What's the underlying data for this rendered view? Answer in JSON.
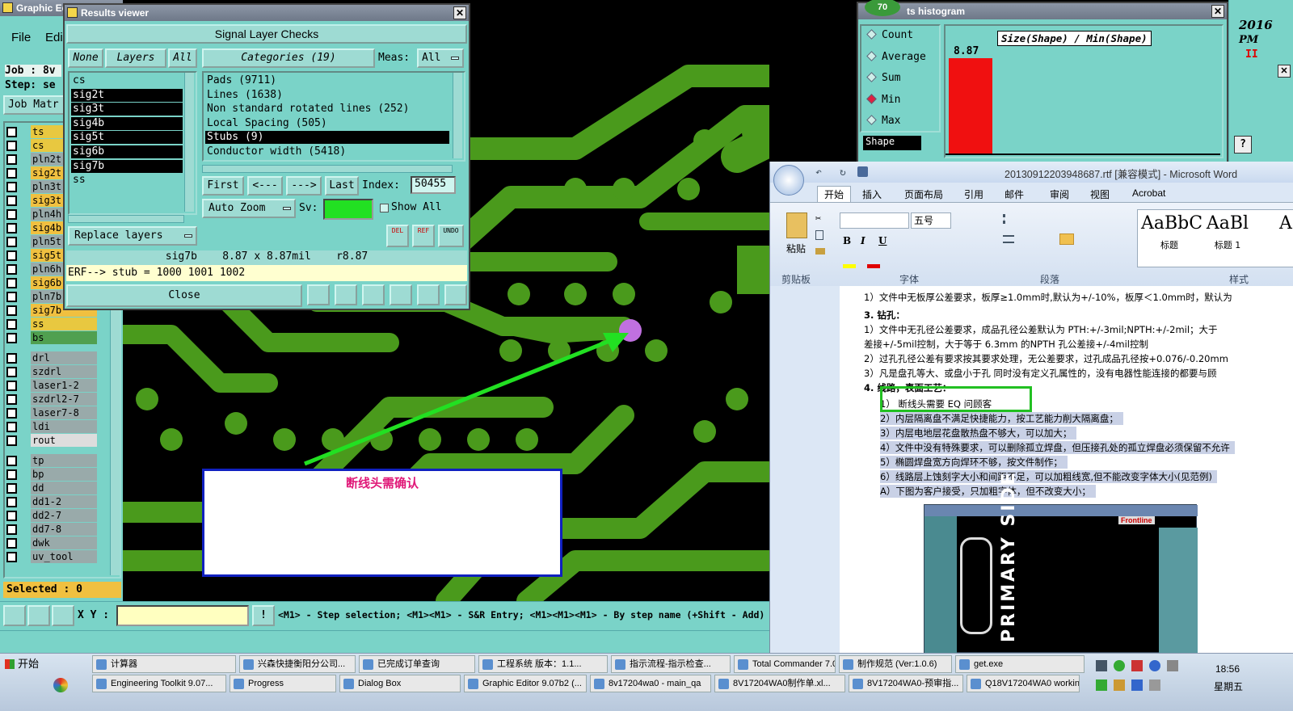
{
  "main_window": {
    "title": "Graphic Ed",
    "menu": {
      "file": "File",
      "edit": "Edi"
    },
    "job_label": "Job : 8v",
    "step_label": "Step: se",
    "job_matrix_button": "Job Matr",
    "layers": [
      {
        "name": "ts",
        "color": "#e8c840"
      },
      {
        "name": "cs",
        "color": "#e8c840"
      },
      {
        "name": "pln2t",
        "color": "#9aa"
      },
      {
        "name": "sig2t",
        "color": "#f0c040"
      },
      {
        "name": "pln3t",
        "color": "#9aa"
      },
      {
        "name": "sig3t",
        "color": "#f0c040"
      },
      {
        "name": "pln4h",
        "color": "#9aa"
      },
      {
        "name": "sig4b",
        "color": "#f0c040"
      },
      {
        "name": "pln5t",
        "color": "#9aa"
      },
      {
        "name": "sig5t",
        "color": "#f0c040"
      },
      {
        "name": "pln6h",
        "color": "#9aa"
      },
      {
        "name": "sig6b",
        "color": "#f0c040"
      },
      {
        "name": "pln7b",
        "color": "#9aa"
      },
      {
        "name": "sig7b",
        "color": "#f0c040"
      },
      {
        "name": "ss",
        "color": "#e8c840"
      },
      {
        "name": "bs",
        "color": "#50a050"
      },
      {
        "name": "drl",
        "color": "#9aa"
      },
      {
        "name": "szdrl",
        "color": "#9aa"
      },
      {
        "name": "laser1-2",
        "color": "#9aa"
      },
      {
        "name": "szdrl2-7",
        "color": "#9aa"
      },
      {
        "name": "laser7-8",
        "color": "#9aa"
      },
      {
        "name": "ldi",
        "color": "#9aa"
      },
      {
        "name": "rout",
        "color": "#ddd"
      },
      {
        "name": "tp",
        "color": "#9aa"
      },
      {
        "name": "bp",
        "color": "#9aa"
      },
      {
        "name": "dd",
        "color": "#9aa"
      },
      {
        "name": "dd1-2",
        "color": "#9aa"
      },
      {
        "name": "dd2-7",
        "color": "#9aa"
      },
      {
        "name": "dd7-8",
        "color": "#9aa"
      },
      {
        "name": "dwk",
        "color": "#9aa"
      },
      {
        "name": "uv_tool",
        "color": "#9aa"
      }
    ],
    "selected_status": "Selected : 0",
    "xy_label": "X Y :",
    "xy_value": "",
    "hint_text": "<M1> - Step selection; <M1><M1> - S&R Entry; <M1><M1><M1> - By step name (+Shift - Add)"
  },
  "results_viewer": {
    "title": "Results viewer",
    "header": "Signal Layer Checks",
    "none_btn": "None",
    "layers_btn": "Layers",
    "all_btn": "All",
    "categories_btn": "Categories (19)",
    "meas_label": "Meas:",
    "meas_value": "All",
    "layer_list": [
      "cs",
      "sig2t",
      "sig3t",
      "sig4b",
      "sig5t",
      "sig6b",
      "sig7b",
      "ss"
    ],
    "category_list": [
      "Pads (9711)",
      "Lines (1638)",
      "Non standard rotated lines (252)",
      "Local Spacing (505)",
      "Stubs (9)",
      "Conductor width (5418)"
    ],
    "selected_category": "Stubs (9)",
    "first_btn": "First",
    "prev_btn": "<---",
    "next_btn": "--->",
    "last_btn": "Last",
    "index_label": "Index:",
    "index_value": "50455",
    "auto_zoom": "Auto Zoom",
    "sv_label": "Sv:",
    "show_all": "Show All",
    "replace_layers": "Replace layers",
    "del_btn": "DEL",
    "ref_btn": "REF",
    "undo_btn": "UNDO",
    "measure_text": "sig7b    8.87 x 8.87mil    r8.87",
    "erf_text": "ERF--> stub = 1000 1001 1002",
    "close_btn": "Close"
  },
  "annotation": {
    "text": "断线头需确认"
  },
  "histogram": {
    "title": "ts histogram",
    "badge": "70",
    "options": [
      "Count",
      "Average",
      "Sum",
      "Min",
      "Max"
    ],
    "selected_option": "Min",
    "shape_label": "Shape",
    "formula": "Size(Shape) / Min(Shape)",
    "bar_value": "8.87"
  },
  "side_clock": {
    "year": "2016",
    "ampm": "PM"
  },
  "word": {
    "title": "20130912203948687.rtf [兼容模式] - Microsoft Word",
    "tabs": [
      "开始",
      "插入",
      "页面布局",
      "引用",
      "邮件",
      "审阅",
      "视图",
      "Acrobat"
    ],
    "font_size": "五号",
    "paste_label": "粘贴",
    "groups": [
      "剪贴板",
      "字体",
      "段落",
      "样式"
    ],
    "styles": [
      {
        "preview": "AaBbC",
        "name": "标题"
      },
      {
        "preview": "AaBl",
        "name": "标题 1"
      },
      {
        "preview": "A",
        "name": ""
      }
    ],
    "doc_lines": [
      "1）文件中无板厚公差要求，板厚≥1.0mm时,默认为+/-10%，板厚＜1.0mm时，默认为",
      "3.   钻孔：",
      "1）文件中无孔径公差要求，成品孔径公差默认为 PTH:+/-3mil;NPTH:+/-2mil；大于",
      "差接+/-5mil控制，大于等于 6.3mm 的NPTH 孔公差接+/-4mil控制",
      "2）过孔孔径公差有要求按其要求处理，无公差要求，过孔成品孔径按+0.076/-0.20mm",
      "3）凡是盘孔等大、或盘小于孔 同时没有定义孔属性的，没有电器性能连接的都要与顾",
      "4.   线路，表面工艺：",
      "1）   断线头需要 EQ 问顾客",
      "2）内层隔离盘不满足快捷能力，按工艺能力削大隔离盘；",
      "3）内层电地层花盘散热盘不够大，可以加大；",
      "4）文件中没有特殊要求，可以删除孤立焊盘，但压接孔处的孤立焊盘必须保留不允许",
      "5）椭圆焊盘宽方向焊环不够，按文件制作；",
      "6）线路层上蚀刻字大小和间距不足，可以加粗线宽,但不能改变字体大小(见范例)",
      "A）下图为客户接受，只加粗字体，但不改变大小；"
    ],
    "embedded_text": "PRIMARY SIDE",
    "embedded_brand": "Frontline"
  },
  "taskbar": {
    "start": "开始",
    "time": "18:56",
    "day": "星期五",
    "row1": [
      "计算器",
      "兴森快捷衡阳分公司...",
      "已完成订单查询",
      "工程系统  版本：1.1...",
      "指示流程-指示检查...",
      "Total Commander 7.0 ...",
      "制作规范 (Ver:1.0.6)",
      "get.exe"
    ],
    "row2": [
      "Engineering Toolkit 9.07...",
      "Progress",
      "Dialog Box",
      "Graphic Editor 9.07b2 (...",
      "8v17204wa0 - main_qa",
      "8V17204WA0制作单.xl...",
      "8V17204WA0-预审指...",
      "Q18V17204WA0 workin..."
    ]
  },
  "colors": {
    "pcb_copper": "#4a9a1c",
    "arrow": "#22e022",
    "teal": "#7ad3c8"
  }
}
